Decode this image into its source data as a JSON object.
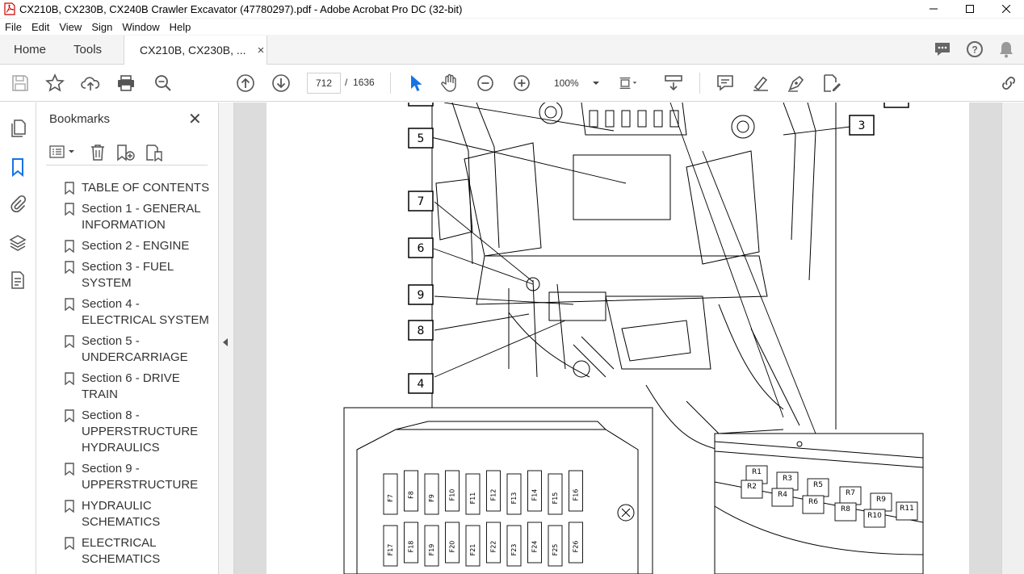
{
  "window": {
    "title": "CX210B, CX230B, CX240B Crawler Excavator (47780297).pdf - Adobe Acrobat Pro DC (32-bit)"
  },
  "menu": [
    "File",
    "Edit",
    "View",
    "Sign",
    "Window",
    "Help"
  ],
  "tabs": {
    "home": "Home",
    "tools": "Tools",
    "document": "CX210B, CX230B, ...",
    "close": "×"
  },
  "toolbar": {
    "current_page": "712",
    "page_separator": "/",
    "total_pages": "1636",
    "zoom": "100%"
  },
  "bookmarks": {
    "title": "Bookmarks",
    "close": "✕",
    "items": [
      {
        "label": "TABLE OF CONTENTS"
      },
      {
        "label": "Section 1 - GENERAL INFORMATION"
      },
      {
        "label": "Section 2 - ENGINE"
      },
      {
        "label": "Section 3 - FUEL SYSTEM"
      },
      {
        "label": "Section 4 - ELECTRICAL SYSTEM"
      },
      {
        "label": "Section 5 - UNDERCARRIAGE"
      },
      {
        "label": "Section 6 - DRIVE TRAIN"
      },
      {
        "label": "Section 8 - UPPERSTRUCTURE HYDRAULICS"
      },
      {
        "label": "Section 9 - UPPERSTRUCTURE"
      },
      {
        "label": "HYDRAULIC SCHEMATICS"
      },
      {
        "label": "ELECTRICAL SCHEMATICS"
      }
    ]
  },
  "diagram": {
    "callouts": [
      "5",
      "7",
      "6",
      "9",
      "8",
      "4",
      "3"
    ],
    "fuses_top": [
      "F7",
      "F8",
      "F9",
      "F10",
      "F11",
      "F12",
      "F13",
      "F14",
      "F15",
      "F16"
    ],
    "fuses_bottom": [
      "F17",
      "F18",
      "F19",
      "F20",
      "F21",
      "F22",
      "F23",
      "F24",
      "F25",
      "F26"
    ],
    "relays": [
      "R1",
      "R2",
      "R3",
      "R4",
      "R5",
      "R6",
      "R7",
      "R8",
      "R9",
      "R10",
      "R11"
    ]
  }
}
